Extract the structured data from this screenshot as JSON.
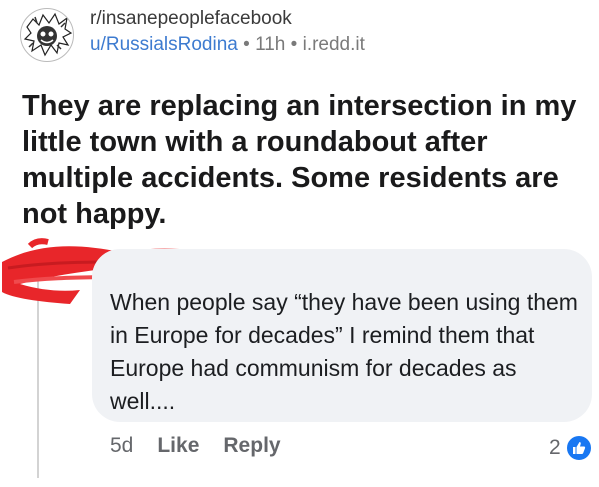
{
  "post": {
    "subreddit": "r/insanepeoplefacebook",
    "author": "u/RussialsRodina",
    "separator": "•",
    "age": "11h",
    "domain": "i.redd.it",
    "title": "They are replacing an intersection in my little town with a roundabout after multiple accidents. Some residents are not happy."
  },
  "comment": {
    "text": "When people say “they have been using them in Europe for decades” I remind them that Europe had communism for decades as well....",
    "time": "5d",
    "like_label": "Like",
    "reply_label": "Reply",
    "reaction_count": "2"
  },
  "colors": {
    "link_blue": "#3d7bd0",
    "redaction_red": "#e8262a",
    "bubble_bg": "#f0f2f5",
    "like_blue": "#1877f2"
  },
  "icons": {
    "subreddit_avatar": "insanepeople-avatar-icon",
    "reaction": "thumbs-up-icon"
  }
}
